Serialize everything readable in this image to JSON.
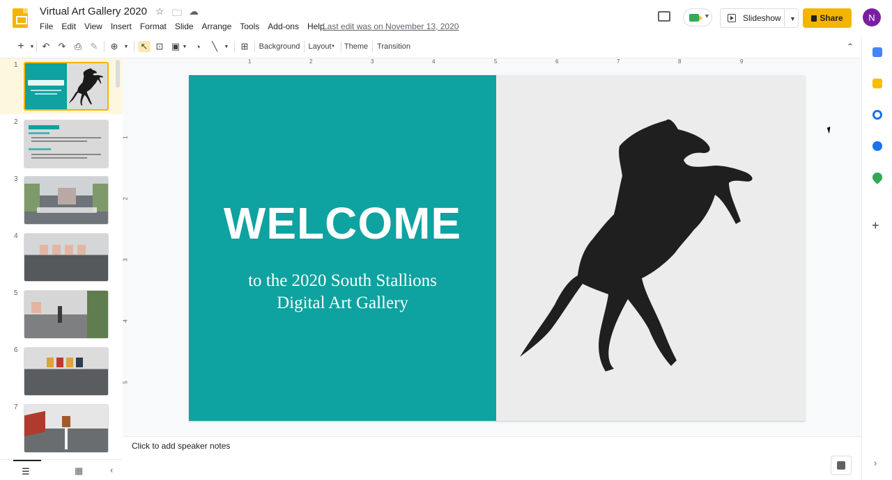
{
  "app": {
    "title": "Virtual Art Gallery 2020",
    "last_edit": "Last edit was on November 13, 2020"
  },
  "menu": [
    "File",
    "Edit",
    "View",
    "Insert",
    "Format",
    "Slide",
    "Arrange",
    "Tools",
    "Add-ons",
    "Help"
  ],
  "header": {
    "slideshow_label": "Slideshow",
    "share_label": "Share",
    "avatar_initial": "N"
  },
  "toolbar": {
    "background_label": "Background",
    "layout_label": "Layout",
    "theme_label": "Theme",
    "transition_label": "Transition"
  },
  "filmstrip": {
    "slides": [
      {
        "number": "1"
      },
      {
        "number": "2"
      },
      {
        "number": "3"
      },
      {
        "number": "4"
      },
      {
        "number": "5"
      },
      {
        "number": "6"
      },
      {
        "number": "7"
      }
    ],
    "selected": 1
  },
  "ruler": {
    "h_labels": [
      "1",
      "2",
      "3",
      "4",
      "5",
      "6",
      "7",
      "8",
      "9"
    ],
    "v_labels": [
      "1",
      "2",
      "3",
      "4",
      "5"
    ]
  },
  "slide": {
    "heading": "WELCOME",
    "subtitle_line1": "to the 2020 South Stallions",
    "subtitle_line2": "Digital Art Gallery",
    "teal_color": "#0ea2a0",
    "bg_color": "#ececec",
    "image": "rearing-horse-silhouette"
  },
  "notes": {
    "placeholder": "Click to add speaker notes"
  },
  "colors": {
    "accent": "#f4b400",
    "avatar": "#7b1fa2"
  }
}
